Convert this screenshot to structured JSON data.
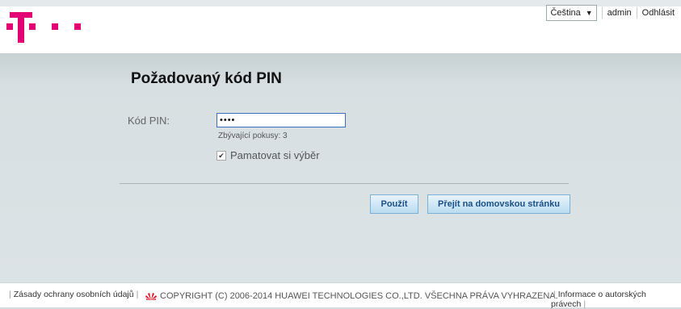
{
  "header": {
    "language": "Čeština",
    "user": "admin",
    "logout": "Odhlásit",
    "brand_color": "#e20074"
  },
  "main": {
    "title": "Požadovaný kód PIN",
    "pin_label": "Kód PIN:",
    "pin_value": "••••",
    "remaining_attempts": "Zbývající pokusy:  3",
    "remember_label": "Pamatovat si výběr",
    "remember_checked": true,
    "apply_button": "Použít",
    "home_button": "Přejít na domovskou stránku"
  },
  "footer": {
    "privacy": "Zásady ochrany osobních údajů",
    "copyright": "COPYRIGHT (C) 2006-2014 HUAWEI TECHNOLOGIES CO.,LTD. VŠECHNA PRÁVA VYHRAZENA.",
    "copyright_info": "Informace o autorských právech"
  }
}
